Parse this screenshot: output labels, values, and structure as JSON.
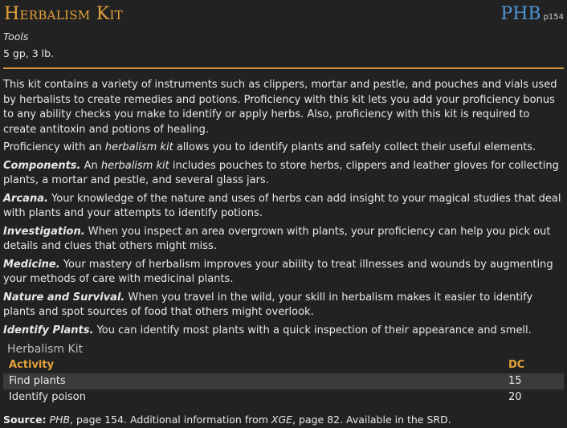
{
  "header": {
    "title": "Herbalism Kit",
    "source_abbr": "PHB",
    "source_page": "p154"
  },
  "meta": {
    "type": "Tools",
    "cost_weight": "5 gp, 3 lb."
  },
  "body": {
    "intro": "This kit contains a variety of instruments such as clippers, mortar and pestle, and pouches and vials used by herbalists to create remedies and potions. Proficiency with this kit lets you add your proficiency bonus to any ability checks you make to identify or apply herbs. Also, proficiency with this kit is required to create antitoxin and potions of healing.",
    "prof_pre": "Proficiency with an ",
    "prof_link": "herbalism kit",
    "prof_post": " allows you to identify plants and safely collect their useful elements.",
    "components_name": "Components.",
    "components_pre": " An ",
    "components_link": "herbalism kit",
    "components_post": " includes pouches to store herbs, clippers and leather gloves for collecting plants, a mortar and pestle, and several glass jars.",
    "entries": [
      {
        "name": "Arcana.",
        "text": " Your knowledge of the nature and uses of herbs can add insight to your magical studies that deal with plants and your attempts to identify potions."
      },
      {
        "name": "Investigation.",
        "text": " When you inspect an area overgrown with plants, your proficiency can help you pick out details and clues that others might miss."
      },
      {
        "name": "Medicine.",
        "text": " Your mastery of herbalism improves your ability to treat illnesses and wounds by augmenting your methods of care with medicinal plants."
      },
      {
        "name": "Nature and Survival.",
        "text": " When you travel in the wild, your skill in herbalism makes it easier to identify plants and spot sources of food that others might overlook."
      },
      {
        "name": "Identify Plants.",
        "text": " You can identify most plants with a quick inspection of their appearance and smell."
      }
    ]
  },
  "table": {
    "caption": "Herbalism Kit",
    "headers": [
      "Activity",
      "DC"
    ],
    "rows": [
      [
        "Find plants",
        "15"
      ],
      [
        "Identify poison",
        "20"
      ]
    ]
  },
  "source_line": {
    "label": "Source:",
    "book1": "PHB",
    "mid1": ", page 154. Additional information from ",
    "book2": "XGE",
    "end": ", page 82. Available in the SRD."
  },
  "colors": {
    "accent": "#e6a23a",
    "source_badge": "#4f95d6",
    "background": "#222222",
    "zebra_row": "#3b3b3b"
  }
}
